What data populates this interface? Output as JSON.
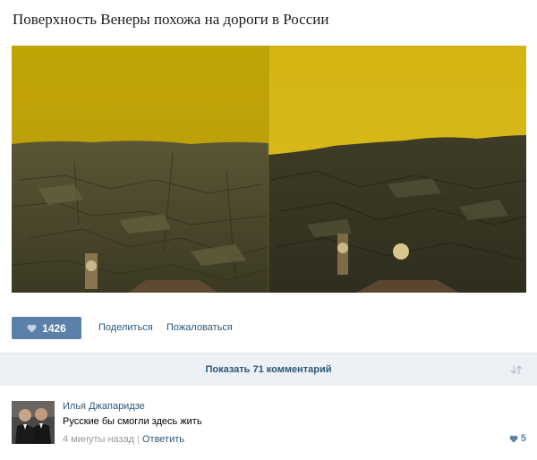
{
  "post": {
    "title": "Поверхность Венеры похожа на дороги в России",
    "image_alt": "Venus surface panorama",
    "colors": {
      "sky": "#c4a80a",
      "ground": "#4d4b2a"
    }
  },
  "actions": {
    "like_count": "1426",
    "share_label": "Поделиться",
    "report_label": "Пожаловаться",
    "like_icon": "heart-icon"
  },
  "comments_bar": {
    "label": "Показать 71 комментарий",
    "sort_icon": "sort-arrows-icon"
  },
  "comment": {
    "author": "Илья Джапаридзе",
    "text": "Русские бы смогли здесь жить",
    "time": "4 минуты назад",
    "separator": "|",
    "reply_label": "Ответить",
    "likes": "5"
  },
  "colors": {
    "accent": "#5b81a8",
    "link": "#2b587a",
    "bar_bg": "#edf0f4"
  }
}
